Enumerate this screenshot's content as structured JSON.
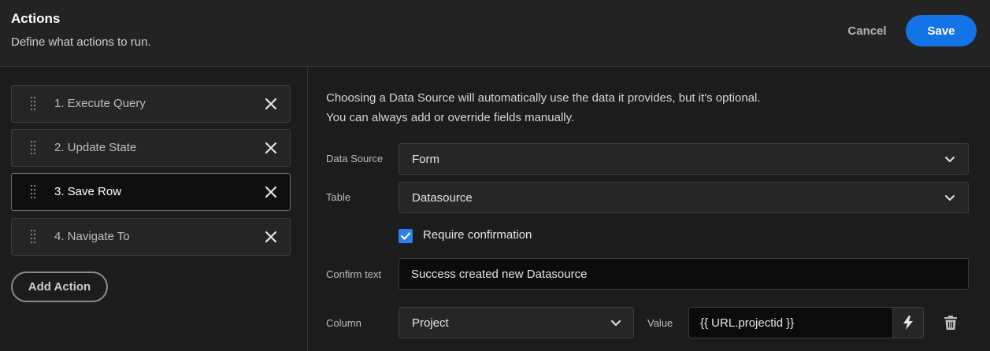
{
  "header": {
    "title": "Actions",
    "subtitle": "Define what actions to run.",
    "cancel_label": "Cancel",
    "save_label": "Save"
  },
  "sidebar": {
    "actions": [
      {
        "label": "1. Execute Query",
        "selected": false
      },
      {
        "label": "2. Update State",
        "selected": false
      },
      {
        "label": "3. Save Row",
        "selected": true
      },
      {
        "label": "4. Navigate To",
        "selected": false
      }
    ],
    "add_action_label": "Add Action"
  },
  "panel": {
    "info_line1": "Choosing a Data Source will automatically use the data it provides, but it's optional.",
    "info_line2": "You can always add or override fields manually.",
    "data_source": {
      "label": "Data Source",
      "value": "Form"
    },
    "table": {
      "label": "Table",
      "value": "Datasource"
    },
    "require_confirmation": {
      "label": "Require confirmation",
      "checked": true
    },
    "confirm_text": {
      "label": "Confirm text",
      "value": "Success created new Datasource"
    },
    "column": {
      "label": "Column",
      "value": "Project"
    },
    "value": {
      "label": "Value",
      "value": "{{ URL.projectid }}"
    }
  },
  "colors": {
    "accent": "#1473e6",
    "checkbox": "#2d7ef0",
    "background": "#1c1c1c"
  },
  "icons": [
    "drag-handle-icon",
    "close-icon",
    "chevron-down-icon",
    "checkmark-icon",
    "lightning-icon",
    "trash-icon"
  ]
}
